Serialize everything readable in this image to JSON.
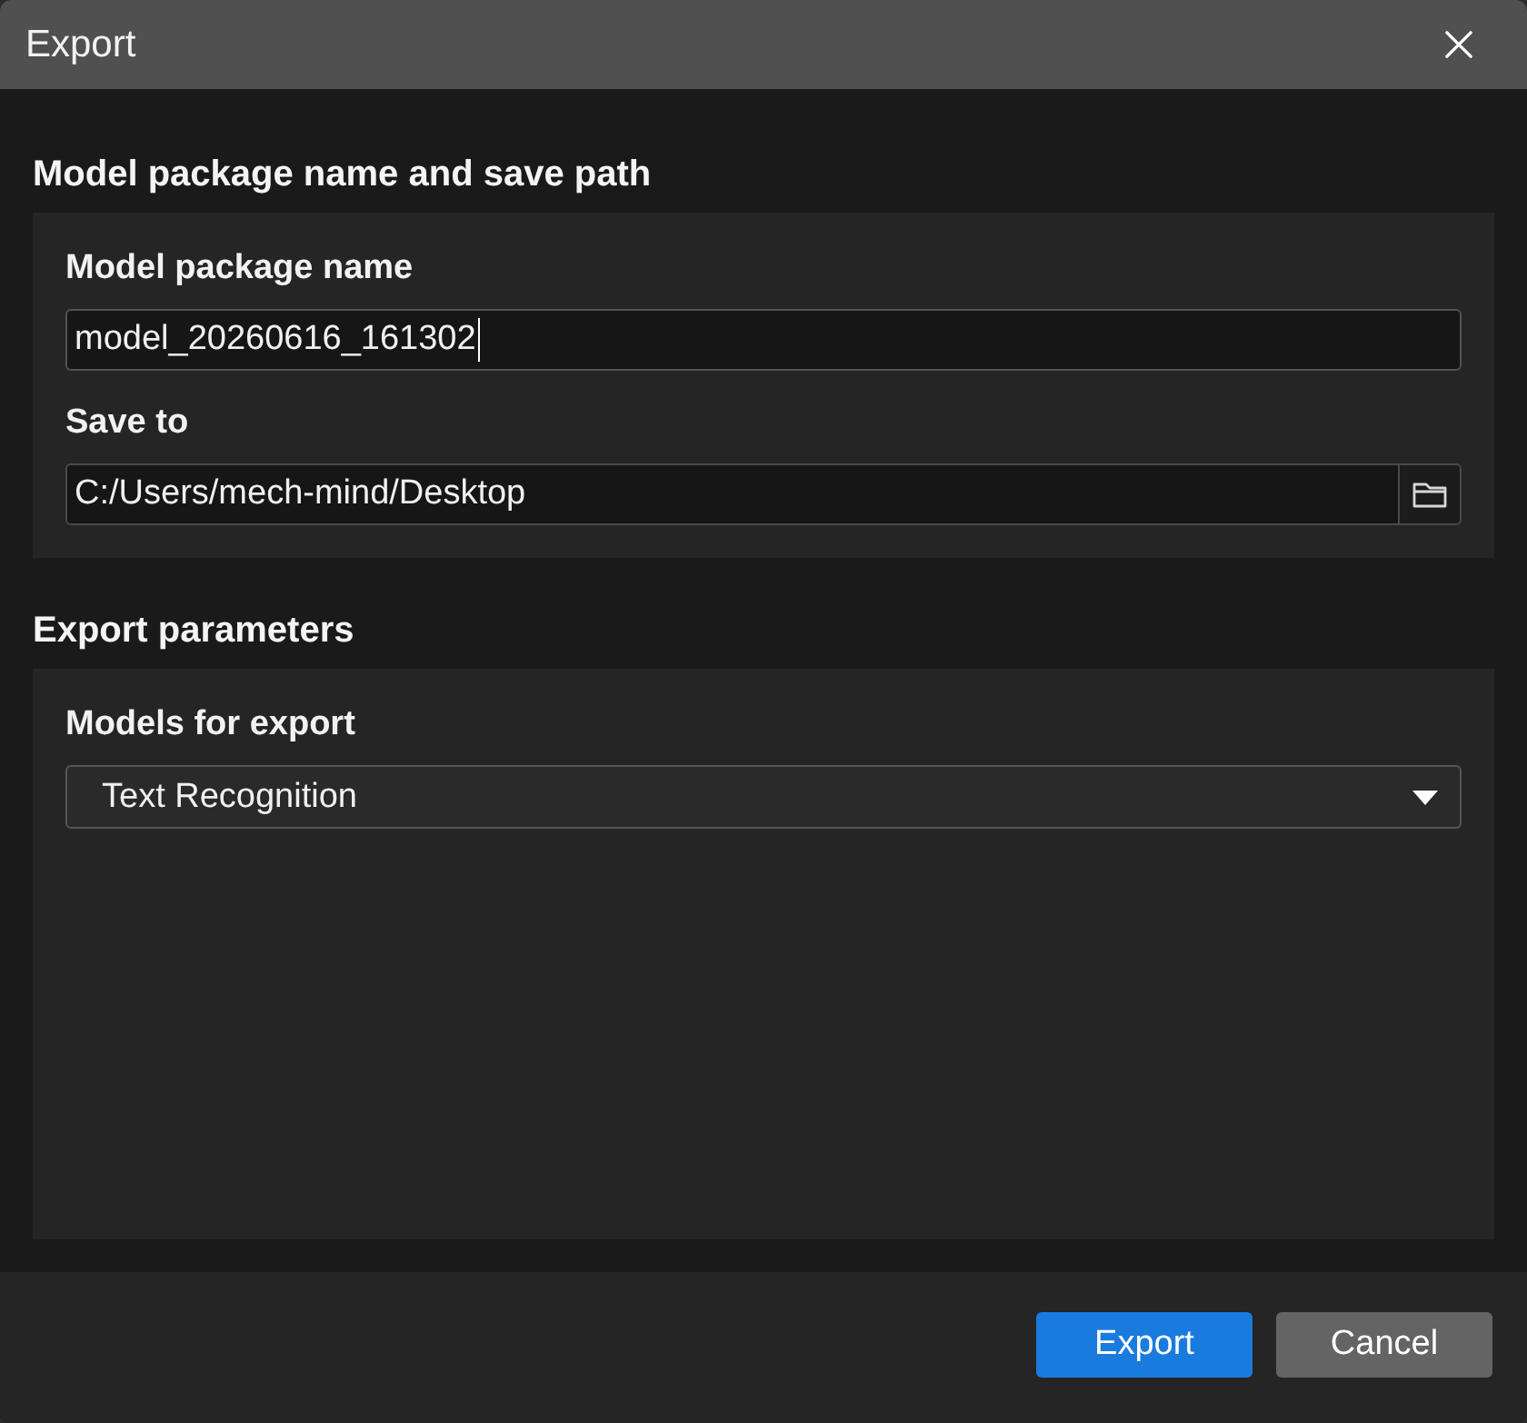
{
  "window": {
    "title": "Export"
  },
  "sections": [
    {
      "heading": "Model package name and save path",
      "fields": [
        {
          "kind": "text",
          "label": "Model package name",
          "value": "model_20260616_161302",
          "focused": true
        },
        {
          "kind": "path",
          "label": "Save to",
          "value": "C:/Users/mech-mind/Desktop",
          "focused": false
        }
      ]
    },
    {
      "heading": "Export parameters",
      "fields": [
        {
          "kind": "dropdown",
          "label": "Models for export",
          "value": "Text Recognition",
          "focused": false
        }
      ]
    }
  ],
  "buttons": [
    {
      "label": "Export",
      "kind": "primary"
    },
    {
      "label": "Cancel",
      "kind": "secondary"
    }
  ]
}
